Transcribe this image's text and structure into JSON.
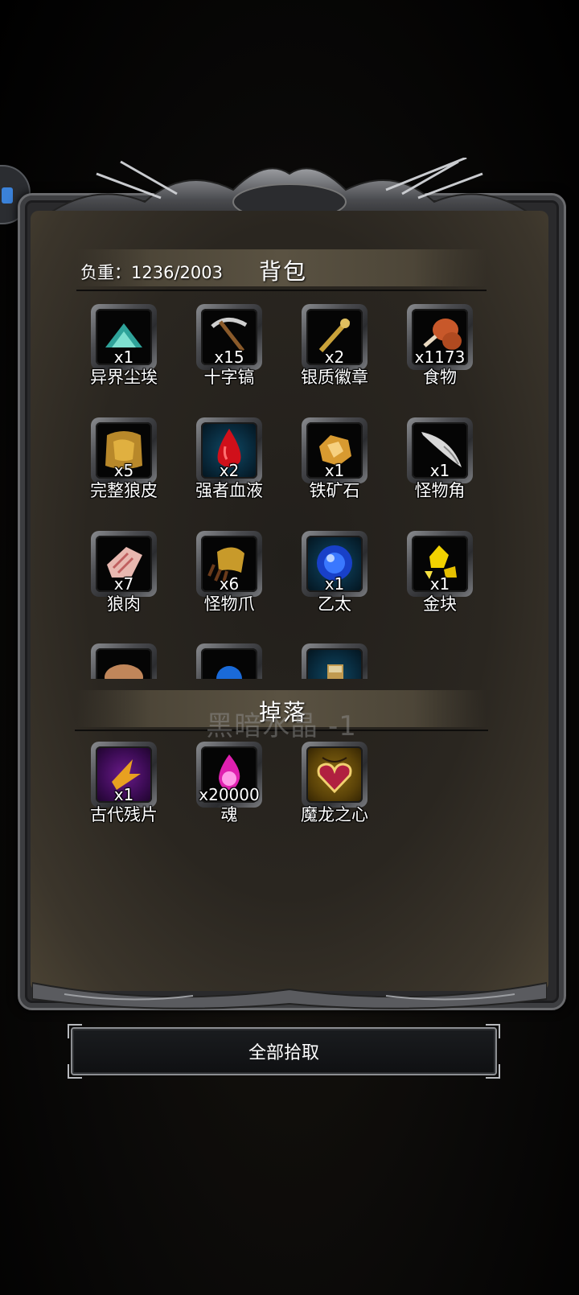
{
  "bag": {
    "weight_label": "负重：1236/2003",
    "title": "背包",
    "items": [
      {
        "name": "异界尘埃",
        "qty": "x1",
        "icon": "dust-pile-icon"
      },
      {
        "name": "十字镐",
        "qty": "x15",
        "icon": "pickaxe-icon"
      },
      {
        "name": "银质徽章",
        "qty": "x2",
        "icon": "silver-badge-icon"
      },
      {
        "name": "食物",
        "qty": "x1173",
        "icon": "meat-drumstick-icon"
      },
      {
        "name": "完整狼皮",
        "qty": "x5",
        "icon": "wolf-pelt-icon"
      },
      {
        "name": "强者血液",
        "qty": "x2",
        "icon": "blood-drop-icon"
      },
      {
        "name": "铁矿石",
        "qty": "x1",
        "icon": "iron-ore-icon"
      },
      {
        "name": "怪物角",
        "qty": "x1",
        "icon": "monster-horn-icon"
      },
      {
        "name": "狼肉",
        "qty": "x7",
        "icon": "wolf-meat-icon"
      },
      {
        "name": "怪物爪",
        "qty": "x6",
        "icon": "monster-claw-icon"
      },
      {
        "name": "乙太",
        "qty": "x1",
        "icon": "ether-orb-icon"
      },
      {
        "name": "金块",
        "qty": "x1",
        "icon": "gold-nugget-icon"
      }
    ],
    "partial_row": [
      {
        "icon": "bread-icon"
      },
      {
        "icon": "blue-orb-icon"
      },
      {
        "icon": "scroll-icon"
      }
    ]
  },
  "drops": {
    "title": "掉落",
    "toast": "黑暗水晶 -1",
    "items": [
      {
        "name": "古代残片",
        "qty": "x1",
        "icon": "ancient-fragment-icon"
      },
      {
        "name": "魂",
        "qty": "x20000",
        "icon": "soul-flame-icon"
      },
      {
        "name": "魔龙之心",
        "qty": "",
        "icon": "dragon-heart-icon"
      }
    ]
  },
  "pickup_all_label": "全部拾取"
}
